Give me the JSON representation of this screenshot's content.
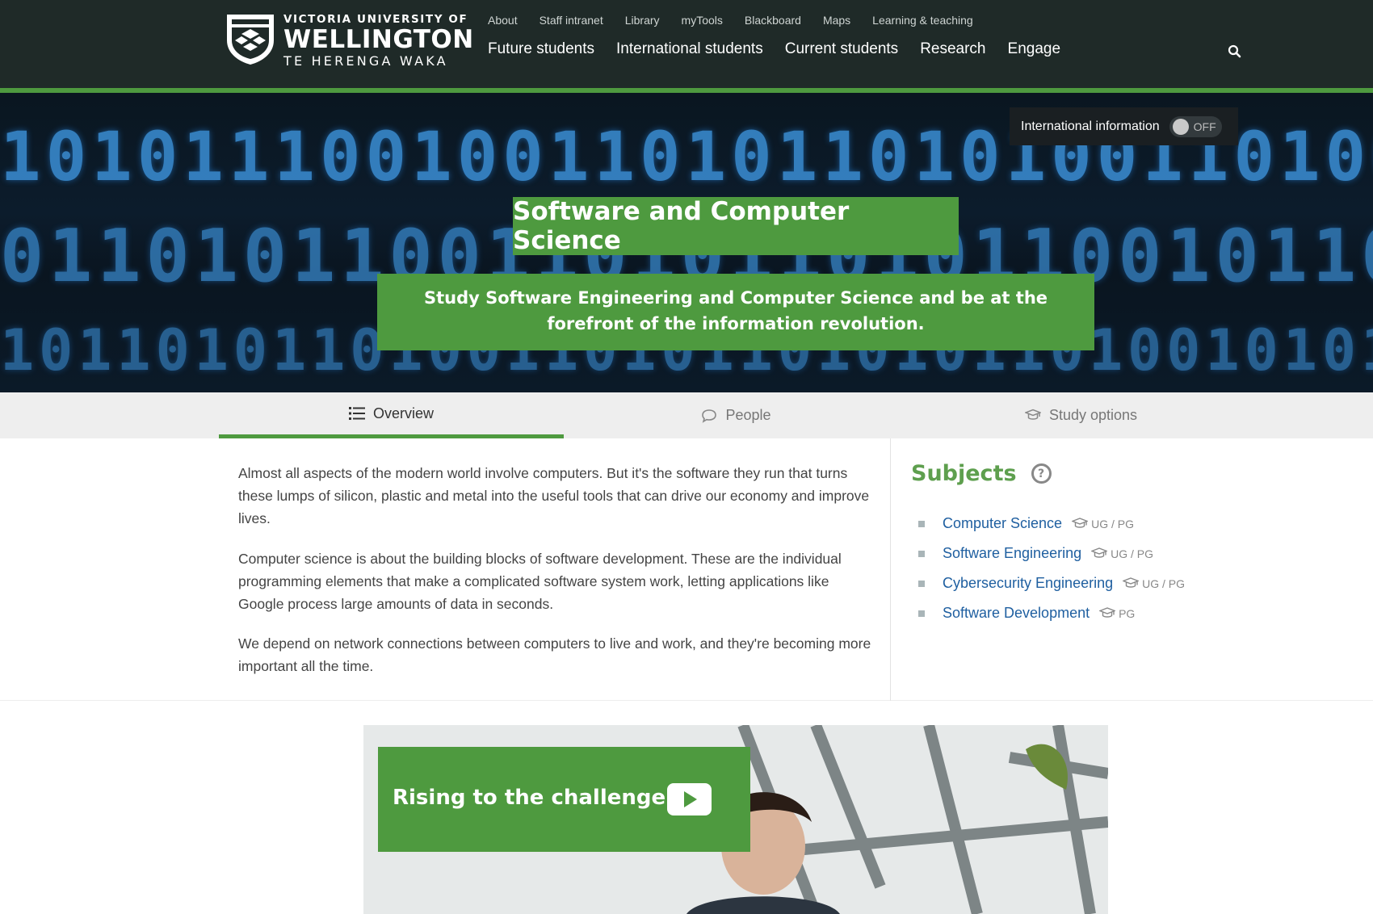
{
  "header": {
    "logo": {
      "line1": "VICTORIA UNIVERSITY OF",
      "line2": "WELLINGTON",
      "line3": "TE HERENGA WAKA"
    },
    "utility_nav": [
      "About",
      "Staff intranet",
      "Library",
      "myTools",
      "Blackboard",
      "Maps",
      "Learning & teaching"
    ],
    "main_nav": [
      "Future students",
      "International students",
      "Current students",
      "Research",
      "Engage"
    ],
    "search_icon": "search-icon"
  },
  "hero": {
    "international_label": "International information",
    "toggle_state": "OFF",
    "title": "Software and Computer Science",
    "subtitle": "Study Software Engineering and Computer Science and be at the forefront of the information revolution."
  },
  "tabs": [
    {
      "label": "Overview",
      "icon": "list-icon",
      "active": true
    },
    {
      "label": "People",
      "icon": "speech-bubble-icon",
      "active": false
    },
    {
      "label": "Study options",
      "icon": "graduation-cap-icon",
      "active": false
    }
  ],
  "content": {
    "paragraphs": [
      "Almost all aspects of the modern world involve computers. But it's the software they run that turns these lumps of silicon, plastic and metal into the useful tools that can drive our economy and improve lives.",
      "Computer science is about the building blocks of software development. These are the individual programming elements that make a complicated software system work, letting applications like Google process large amounts of data in seconds.",
      "We depend on network connections between computers to live and work, and they're becoming more important all the time."
    ]
  },
  "subjects": {
    "title": "Subjects",
    "help": "?",
    "items": [
      {
        "name": "Computer Science",
        "levels": "UG / PG"
      },
      {
        "name": "Software Engineering",
        "levels": "UG / PG"
      },
      {
        "name": "Cybersecurity Engineering",
        "levels": "UG / PG"
      },
      {
        "name": "Software Development",
        "levels": "PG"
      }
    ]
  },
  "video": {
    "title": "Rising to the challenge"
  },
  "colors": {
    "header_bg": "#1f2a28",
    "accent_green": "#4e9a3f",
    "link_blue": "#1f5fa0"
  }
}
